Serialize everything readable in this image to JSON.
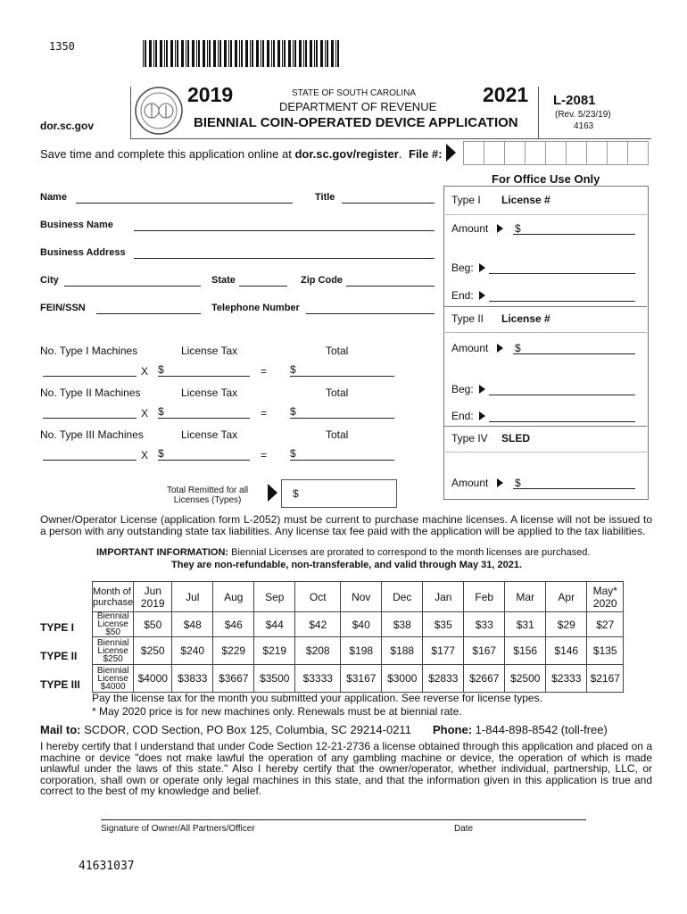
{
  "top_code": "1350",
  "header": {
    "website": "dor.sc.gov",
    "year_start": "2019",
    "year_end": "2021",
    "state": "STATE OF SOUTH CAROLINA",
    "department": "DEPARTMENT OF REVENUE",
    "title": "BIENNIAL COIN-OPERATED DEVICE APPLICATION",
    "form_id": "L-2081",
    "revision": "(Rev. 5/23/19)",
    "form_number": "4163"
  },
  "online": {
    "text": "Save time and complete this application online at ",
    "link": "dor.sc.gov/register",
    "suffix": ".",
    "file_label": "File #:"
  },
  "fields": {
    "name": "Name",
    "title": "Title",
    "business_name": "Business Name",
    "business_address": "Business Address",
    "city": "City",
    "state": "State",
    "zip": "Zip Code",
    "fein": "FEIN/SSN",
    "telephone": "Telephone Number"
  },
  "machines": [
    {
      "label": "No. Type I Machines",
      "tax": "License Tax",
      "total": "Total"
    },
    {
      "label": "No. Type II Machines",
      "tax": "License Tax",
      "total": "Total"
    },
    {
      "label": "No. Type III Machines",
      "tax": "License Tax",
      "total": "Total"
    }
  ],
  "calc": {
    "times": "X",
    "dollar": "$",
    "equals": "="
  },
  "total_remitted": {
    "line1": "Total Remitted for all",
    "line2": "Licenses (Types)",
    "dollar": "$"
  },
  "office": {
    "heading": "For Office Use Only",
    "type1": "Type I",
    "type2": "Type II",
    "type4": "Type IV",
    "license": "License #",
    "sled": "SLED",
    "amount": "Amount",
    "beg": "Beg:",
    "end": "End:",
    "dollar": "$"
  },
  "notice": "Owner/Operator License (application form L-2052) must be current to purchase machine licenses. A license will not be issued to a person with any outstanding state tax liabilities. Any license tax fee paid with the application will be applied to the tax liabilities.",
  "important": {
    "label": "IMPORTANT INFORMATION:",
    "text": " Biennial Licenses are prorated to correspond to the month licenses are purchased.",
    "line2": "They are non-refundable, non-transferable, and valid through May 31, 2021."
  },
  "rates": {
    "header": [
      "Month of purchase",
      "Jun 2019",
      "Jul",
      "Aug",
      "Sep",
      "Oct",
      "Nov",
      "Dec",
      "Jan",
      "Feb",
      "Mar",
      "Apr",
      "May* 2020"
    ],
    "rows": [
      {
        "type": "TYPE I",
        "label": "Biennial License $50",
        "values": [
          "$50",
          "$48",
          "$46",
          "$44",
          "$42",
          "$40",
          "$38",
          "$35",
          "$33",
          "$31",
          "$29",
          "$27"
        ]
      },
      {
        "type": "TYPE II",
        "label": "Biennial License $250",
        "values": [
          "$250",
          "$240",
          "$229",
          "$219",
          "$208",
          "$198",
          "$188",
          "$177",
          "$167",
          "$156",
          "$146",
          "$135"
        ]
      },
      {
        "type": "TYPE III",
        "label": "Biennial License $4000",
        "values": [
          "$4000",
          "$3833",
          "$3667",
          "$3500",
          "$3333",
          "$3167",
          "$3000",
          "$2833",
          "$2667",
          "$2500",
          "$2333",
          "$2167"
        ]
      }
    ],
    "note1": "Pay the license tax for the month you submitted your application. See reverse for license types.",
    "note2": "* May 2020 price is for new machines only. Renewals must be at biennial rate."
  },
  "mail": {
    "label": "Mail to:",
    "address": " SCDOR, COD Section, PO Box 125, Columbia, SC 29214-0211",
    "phone_label": "Phone:",
    "phone": " 1-844-898-8542 (toll-free)"
  },
  "certify": "I hereby certify that I understand that under Code Section 12-21-2736 a license obtained through this application and placed on a machine or device \"does not make lawful the operation of any gambling machine or device, the operation of which is made unlawful under the laws of this state.\" Also I hereby certify that the owner/operator, whether individual, partnership, LLC, or corporation, shall own or operate only legal machines in this state, and that the information given in this application is true and correct to the best of my knowledge and belief.",
  "signature": {
    "label": "Signature of Owner/All Partners/Officer",
    "date": "Date"
  },
  "bottom_code": "41631037"
}
